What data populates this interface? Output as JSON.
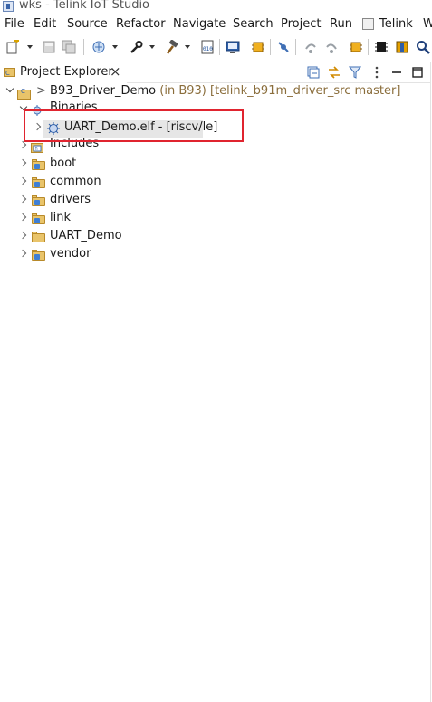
{
  "window": {
    "title": "wks - Telink IoT Studio"
  },
  "menu": [
    "File",
    "Edit",
    "Source",
    "Refactor",
    "Navigate",
    "Search",
    "Project",
    "Run",
    "Telink",
    "W"
  ],
  "view": {
    "tab_label": "Project Explorer"
  },
  "tree": {
    "project": {
      "decoration": ">",
      "name": "B93_Driver_Demo",
      "location": "(in B93)",
      "repo": "[telink_b91m_driver_src master]"
    },
    "binaries_label": "Binaries",
    "binary_item": "UART_Demo.elf - [riscv/le]",
    "folders": [
      "Includes",
      "boot",
      "common",
      "drivers",
      "link",
      "UART_Demo",
      "vendor"
    ]
  },
  "colors": {
    "highlight_border": "#e0242f",
    "folder_fill": "#e9c46a",
    "decoration_text": "#8a6d3b"
  }
}
